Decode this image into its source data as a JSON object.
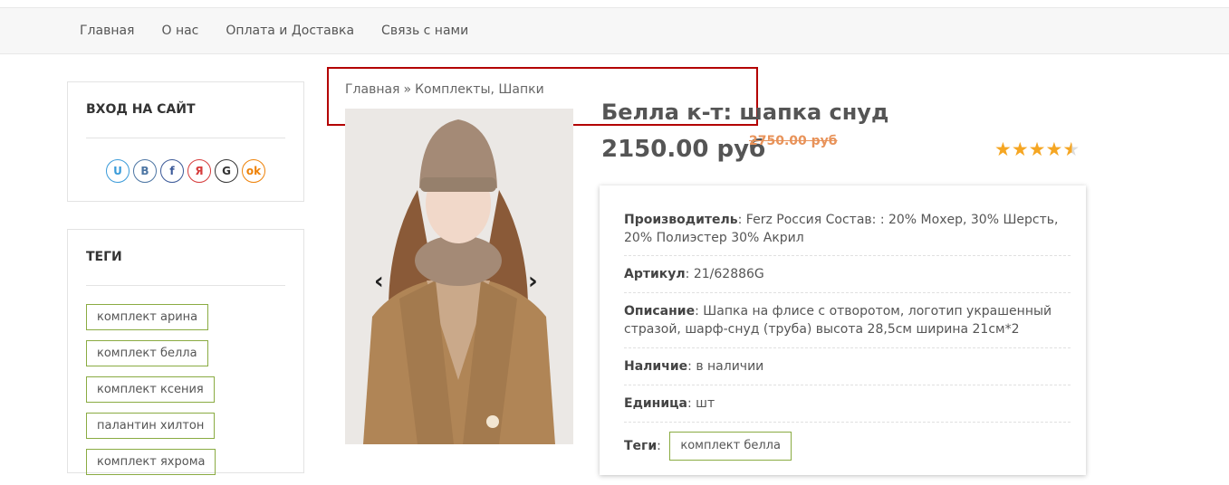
{
  "nav": [
    "Главная",
    "О нас",
    "Оплата и Доставка",
    "Связь с нами"
  ],
  "login": {
    "title": "ВХОД НА САЙТ",
    "socials": [
      {
        "letter": "U",
        "color": "#3a9bd9"
      },
      {
        "letter": "B",
        "color": "#4c75a3"
      },
      {
        "letter": "f",
        "color": "#3b5998"
      },
      {
        "letter": "Я",
        "color": "#d63c3c"
      },
      {
        "letter": "G",
        "color": "#333333"
      },
      {
        "letter": "ok",
        "color": "#ee8208"
      }
    ]
  },
  "tags_widget": {
    "title": "ТЕГИ",
    "items": [
      "комплект арина",
      "комплект белла",
      "комплект ксения",
      "палантин хилтон",
      "комплект яхрома"
    ]
  },
  "breadcrumb": {
    "home": "Главная",
    "separator": "»",
    "categories": "Комплекты, Шапки"
  },
  "product": {
    "title": "Белла к-т: шапка снуд",
    "price": "2150.00 руб",
    "old_price": "2750.00 руб",
    "rating": 4.5
  },
  "details": {
    "manufacturer_label": "Производитель",
    "manufacturer_value": "Ferz Россия Состав: : 20% Мохер, 30% Шерсть, 20% Полиэстер 30% Акрил",
    "article_label": "Артикул",
    "article_value": "21/62886G",
    "description_label": "Описание",
    "description_value": "Шапка на флисе с отворотом, логотип украшенный стразой, шарф-снуд (труба) высота 28,5см ширина 21см*2",
    "availability_label": "Наличие",
    "availability_value": "в наличии",
    "unit_label": "Единица",
    "unit_value": "шт",
    "tags_label": "Теги",
    "tags_value": "комплект белла"
  }
}
